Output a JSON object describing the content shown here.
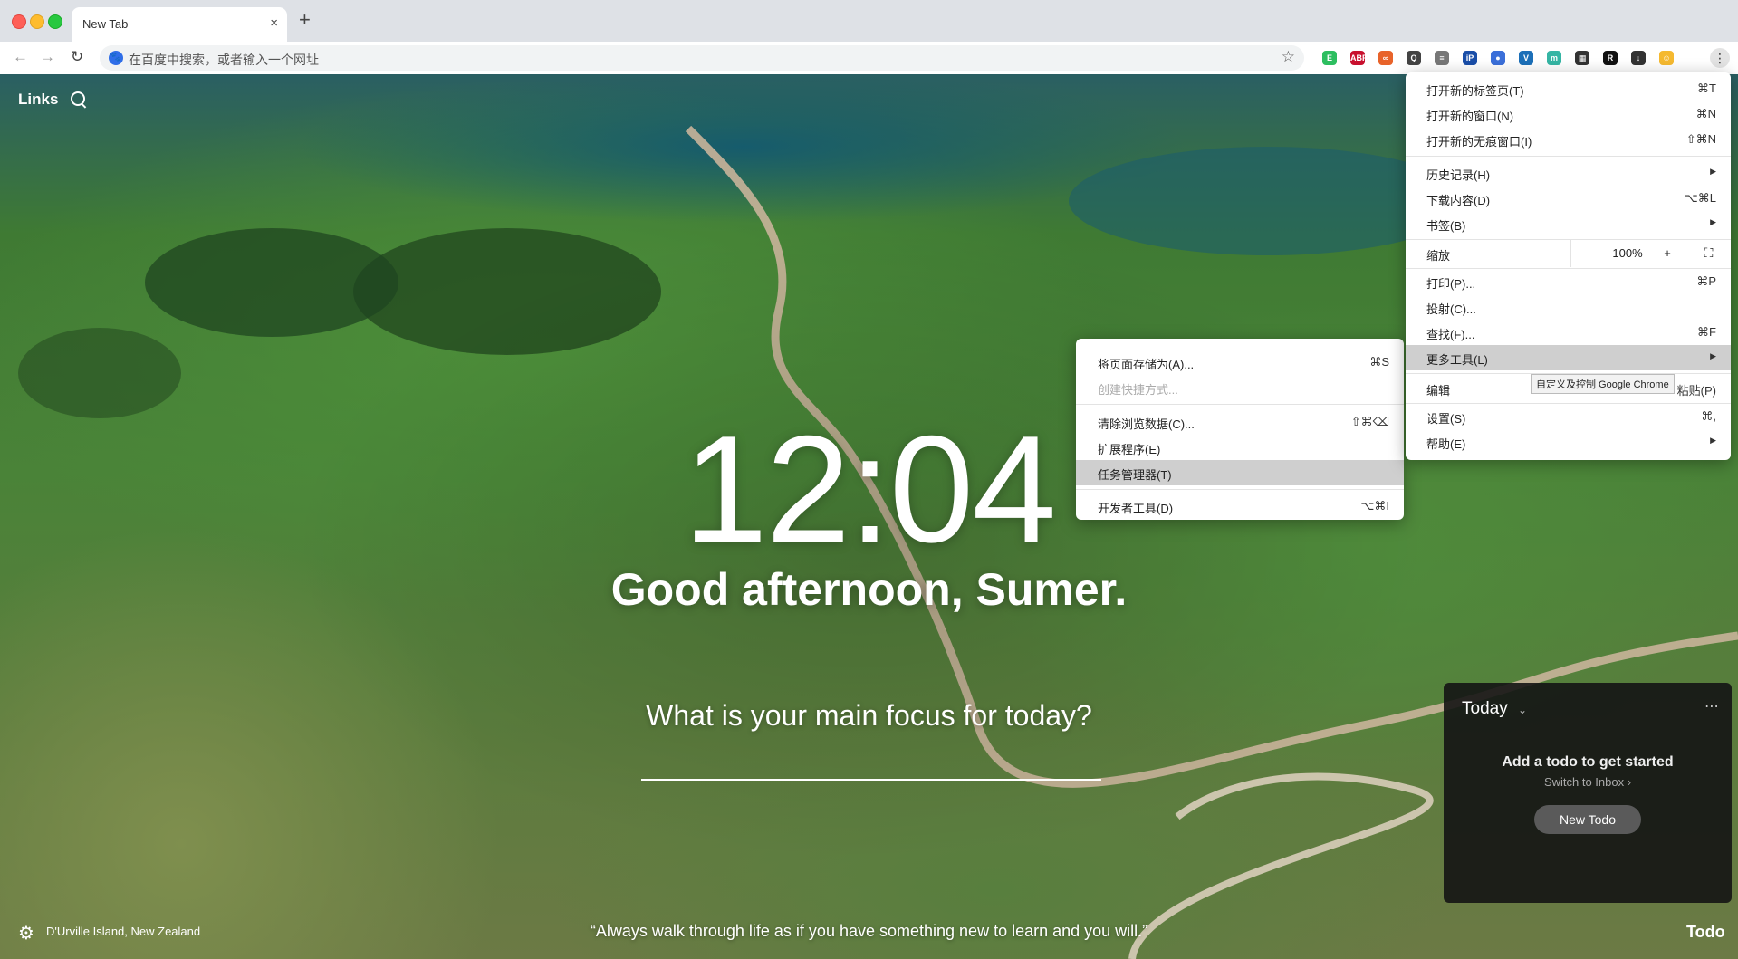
{
  "browser": {
    "tab_title": "New Tab",
    "tab_close": "×",
    "new_tab": "+",
    "omnibox_placeholder": "在百度中搜索，或者输入一个网址",
    "star": "☆"
  },
  "page": {
    "links_label": "Links",
    "clock": "12:04",
    "greeting": "Good afternoon, Sumer.",
    "focus_question": "What is your main focus for today?",
    "location": "D'Urville Island, New Zealand",
    "quote": "“Always walk through life as if you have something new to learn and you will.”",
    "todo_link": "Todo"
  },
  "todo": {
    "title": "Today",
    "empty_heading": "Add a todo to get started",
    "switch_link": "Switch to Inbox ›",
    "new_button": "New Todo"
  },
  "menu": {
    "new_tab": {
      "label": "打开新的标签页(T)",
      "shortcut": "⌘T"
    },
    "new_window": {
      "label": "打开新的窗口(N)",
      "shortcut": "⌘N"
    },
    "incognito": {
      "label": "打开新的无痕窗口(I)",
      "shortcut": "⇧⌘N"
    },
    "history": {
      "label": "历史记录(H)"
    },
    "downloads": {
      "label": "下载内容(D)",
      "shortcut": "⌥⌘L"
    },
    "bookmarks": {
      "label": "书签(B)"
    },
    "zoom": {
      "label": "缩放",
      "minus": "–",
      "value": "100%",
      "plus": "+"
    },
    "print": {
      "label": "打印(P)...",
      "shortcut": "⌘P"
    },
    "cast": {
      "label": "投射(C)..."
    },
    "find": {
      "label": "查找(F)...",
      "shortcut": "⌘F"
    },
    "more_tools": {
      "label": "更多工具(L)"
    },
    "edit": {
      "label": "编辑",
      "paste": "粘贴(P)"
    },
    "settings": {
      "label": "设置(S)",
      "shortcut": "⌘,"
    },
    "help": {
      "label": "帮助(E)"
    },
    "tooltip": "自定义及控制 Google Chrome"
  },
  "submenu": {
    "save_page": {
      "label": "将页面存储为(A)...",
      "shortcut": "⌘S"
    },
    "create_shortcut": {
      "label": "创建快捷方式..."
    },
    "clear_data": {
      "label": "清除浏览数据(C)...",
      "shortcut": "⇧⌘⌫"
    },
    "extensions": {
      "label": "扩展程序(E)"
    },
    "task_manager": {
      "label": "任务管理器(T)"
    },
    "dev_tools": {
      "label": "开发者工具(D)",
      "shortcut": "⌥⌘I"
    }
  },
  "extensions": [
    {
      "name": "evernote-icon",
      "color": "#2dbe60",
      "glyph": "E"
    },
    {
      "name": "adblock-plus-icon",
      "color": "#c8102e",
      "glyph": "ABP"
    },
    {
      "name": "extension-icon",
      "color": "#e8632a",
      "glyph": "∞"
    },
    {
      "name": "search-extension-icon",
      "color": "#444444",
      "glyph": "Q"
    },
    {
      "name": "reader-extension-icon",
      "color": "#777777",
      "glyph": "≡"
    },
    {
      "name": "pixiv-icon",
      "color": "#1a4ea8",
      "glyph": "iP"
    },
    {
      "name": "globe-extension-icon",
      "color": "#3b6fd9",
      "glyph": "●"
    },
    {
      "name": "vue-devtools-icon",
      "color": "#1c6fb8",
      "glyph": "V"
    },
    {
      "name": "momentum-icon",
      "color": "#35b5a4",
      "glyph": "m"
    },
    {
      "name": "qr-code-icon",
      "color": "#333333",
      "glyph": "▦"
    },
    {
      "name": "readwise-icon",
      "color": "#111111",
      "glyph": "R"
    },
    {
      "name": "download-extension-icon",
      "color": "#333333",
      "glyph": "↓"
    },
    {
      "name": "profile-avatar-icon",
      "color": "#f5b930",
      "glyph": "☺"
    }
  ]
}
